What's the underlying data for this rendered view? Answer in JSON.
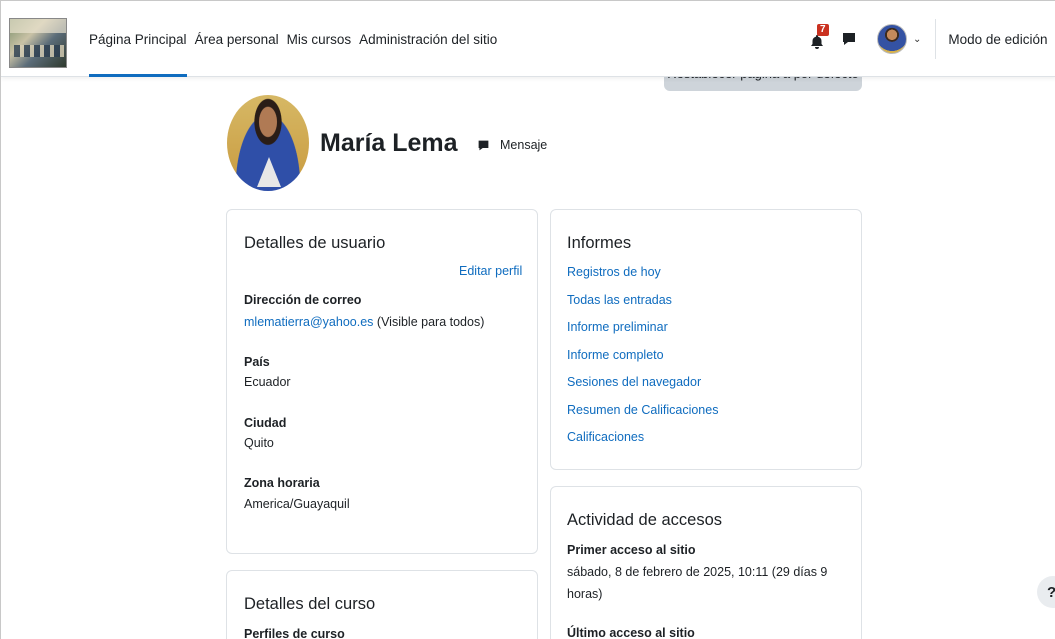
{
  "navbar": {
    "links": [
      "Página Principal",
      "Área personal",
      "Mis cursos",
      "Administración del sitio"
    ],
    "notification_count": "7",
    "edit_mode_label": "Modo de edición"
  },
  "reset_button": "Restablecer página a por defecto",
  "profile": {
    "name": "María Lema",
    "message_label": "Mensaje"
  },
  "user_details": {
    "title": "Detalles de usuario",
    "edit_link": "Editar perfil",
    "email_label": "Dirección de correo",
    "email": "mlematierra@yahoo.es",
    "email_visibility": "(Visible para todos)",
    "country_label": "País",
    "country": "Ecuador",
    "city_label": "Ciudad",
    "city": "Quito",
    "timezone_label": "Zona horaria",
    "timezone": "America/Guayaquil"
  },
  "reports": {
    "title": "Informes",
    "links": [
      "Registros de hoy",
      "Todas las entradas",
      "Informe preliminar",
      "Informe completo",
      "Sesiones del navegador",
      "Resumen de Calificaciones",
      "Calificaciones"
    ]
  },
  "access_activity": {
    "title": "Actividad de accesos",
    "first_access_label": "Primer acceso al sitio",
    "first_access_line1": "sábado, 8 de febrero de 2025, 10:11  (29 días 9",
    "first_access_line2": "horas)",
    "last_access_label": "Último acceso al sitio"
  },
  "course_details": {
    "title": "Detalles del curso",
    "course_profiles_label": "Perfiles de curso"
  },
  "help_label": "?"
}
